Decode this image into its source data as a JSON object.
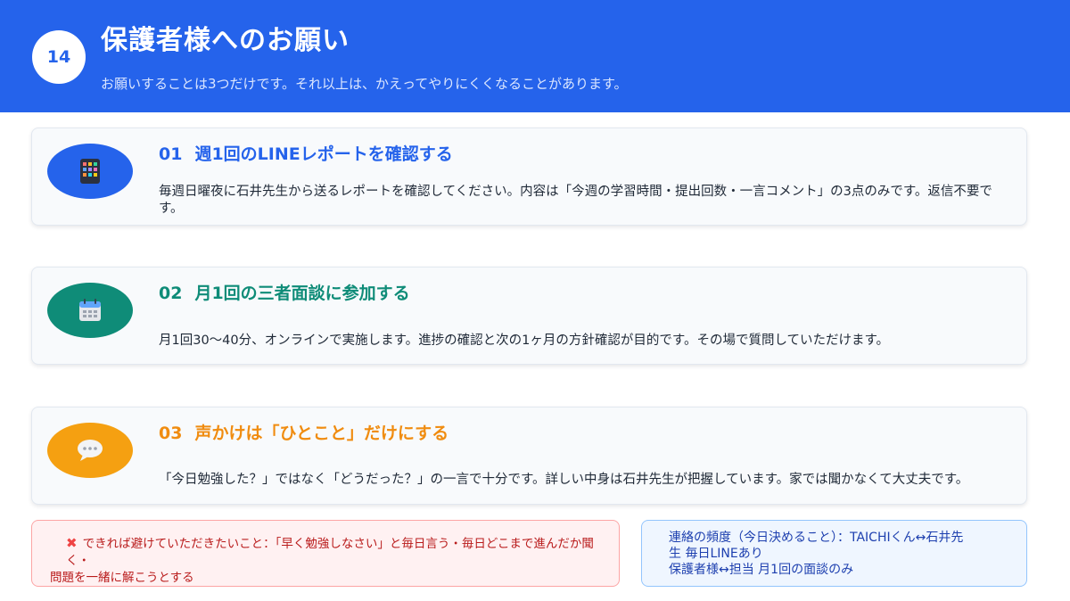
{
  "header": {
    "page_number": "14",
    "title": "保護者様へのお願い",
    "subtitle": "お願いすることは3つだけです。それ以上は、かえってやりにくくなることがあります。"
  },
  "cards": [
    {
      "number": "01",
      "title": "週1回のLINEレポートを確認する",
      "body": "毎週日曜夜に石井先生から送るレポートを確認してください。内容は「今週の学習時間・提出回数・一言コメント」の3点のみです。返信不要です。",
      "icon": "mobile-app-icon",
      "accent_color": "#2563EB",
      "icon_bg": "#2563EB"
    },
    {
      "number": "02",
      "title": "月1回の三者面談に参加する",
      "body": "月1回30～40分、オンラインで実施します。進捗の確認と次の1ヶ月の方針確認が目的です。その場で質問していただけます。",
      "icon": "calendar-icon",
      "accent_color": "#0F8C78",
      "icon_bg": "#0F8C78"
    },
    {
      "number": "03",
      "title": "声かけは「ひとこと」だけにする",
      "body": "「今日勉強した？」ではなく「どうだった？」の一言で十分です。詳しい中身は石井先生が把握しています。家では聞かなくて大丈夫です。",
      "icon": "speech-bubble-icon",
      "accent_color": "#F08C10",
      "icon_bg": "#F5A011"
    }
  ],
  "warning_note": {
    "icon": "cross-mark-icon",
    "line1": "できれば避けていただきたいこと：「早く勉強しなさい」と毎日言う・毎日どこまで進んだか聞く・",
    "line2": "問題を一緒に解こうとする"
  },
  "info_note": {
    "line1": "連絡の頻度（今日決めること）：TAICHIくん↔石井先",
    "line2": "生 毎日LINEあり",
    "line3": "保護者様↔担当 月1回の面談のみ"
  }
}
